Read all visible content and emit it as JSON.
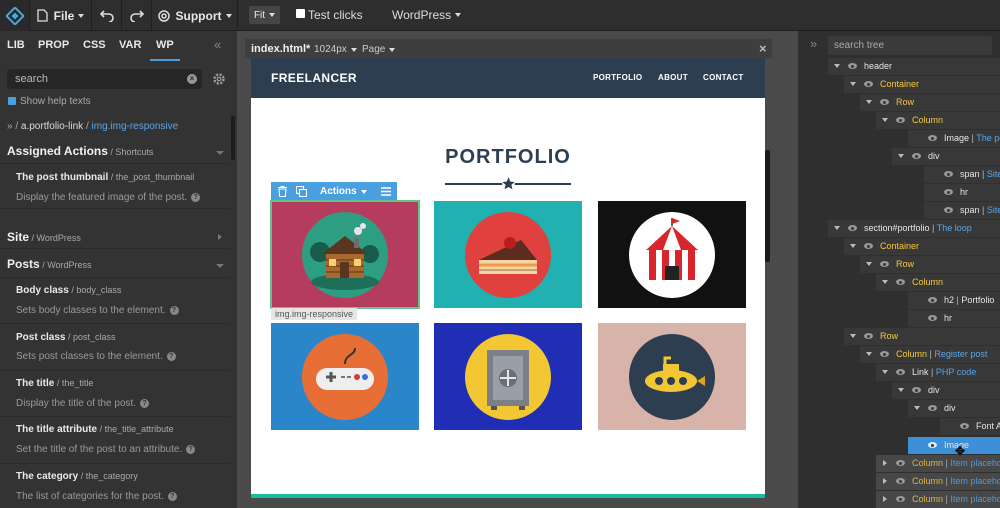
{
  "toolbar": {
    "file_label": "File",
    "support_label": "Support",
    "fit_label": "Fit",
    "test_clicks_label": "Test clicks",
    "wordpress_label": "WordPress"
  },
  "left_panel": {
    "tabs": [
      "LIB",
      "PROP",
      "CSS",
      "VAR",
      "WP"
    ],
    "active_tab": "WP",
    "search_placeholder": "search",
    "show_help_label": "Show help texts",
    "breadcrumb_prefix": "» / ",
    "breadcrumb_link": "a.portfolio-link",
    "breadcrumb_sep": " / ",
    "breadcrumb_current": "img.img-responsive",
    "assigned_actions_title": "Assigned Actions",
    "assigned_actions_sub": " / Shortcuts",
    "post_thumbnail_title": "The post thumbnail",
    "post_thumbnail_sub": " / the_post_thumbnail",
    "post_thumbnail_desc": "Display the featured image of the post.",
    "site_title": "Site",
    "site_sub": " / WordPress",
    "posts_title": "Posts",
    "posts_sub": " / WordPress",
    "items": [
      {
        "title": "Body class",
        "sub": " / body_class",
        "desc": "Sets body classes to the element."
      },
      {
        "title": "Post class",
        "sub": " / post_class",
        "desc": "Sets post classes to the element."
      },
      {
        "title": "The title",
        "sub": " / the_title",
        "desc": "Display the title of the post."
      },
      {
        "title": "The title attribute",
        "sub": " / the_title_attribute",
        "desc": "Set the title of the post to an attribute."
      },
      {
        "title": "The category",
        "sub": " / the_category",
        "desc": "The list of categories for the post."
      }
    ]
  },
  "canvas": {
    "file_name": "index.html*",
    "width_label": "1024px",
    "page_label": "Page",
    "brand": "FREELANCER",
    "nav": [
      "PORTFOLIO",
      "ABOUT",
      "CONTACT"
    ],
    "heading": "PORTFOLIO",
    "actions_label": "Actions",
    "selected_label": "img.img-responsive",
    "thumb_colors": [
      "#b63c5e",
      "#22b1b1",
      "#111111",
      "#2a86c8",
      "#1f2eb5",
      "#d7b3a9"
    ]
  },
  "right_panel": {
    "search_placeholder": "search tree",
    "rows": [
      {
        "text": "header",
        "cls": ""
      },
      {
        "text": "Container",
        "cls": "y"
      },
      {
        "text": "Row",
        "cls": "y"
      },
      {
        "text": "Column",
        "cls": "y"
      },
      {
        "text": "Image",
        "sep": " | ",
        "extra": "The post thumbnail"
      },
      {
        "text": "div",
        "cls": ""
      },
      {
        "text": "span",
        "sep": " | ",
        "extra": "Site name"
      },
      {
        "text": "hr",
        "cls": ""
      },
      {
        "text": "span",
        "sep": " | ",
        "extra": "Site description"
      },
      {
        "text": "section#portfolio",
        "sep": " | ",
        "extra": "The loop"
      },
      {
        "text": "Container",
        "cls": "y"
      },
      {
        "text": "Row",
        "cls": "y"
      },
      {
        "text": "Column",
        "cls": "y"
      },
      {
        "text": "h2",
        "sep": " | ",
        "extra": "Portfolio",
        "extra_cls": "plain"
      },
      {
        "text": "hr",
        "cls": ""
      },
      {
        "text": "Row",
        "cls": "y"
      },
      {
        "text": "Column",
        "cls": "y",
        "sep": " | ",
        "extra": "Register post"
      },
      {
        "text": "Link",
        "sep": " | ",
        "extra": "PHP code"
      },
      {
        "text": "div",
        "cls": ""
      },
      {
        "text": "div",
        "cls": ""
      },
      {
        "text": "Font Awesome",
        "cls": ""
      },
      {
        "text": "Image",
        "cls": ""
      },
      {
        "text": "Column",
        "cls": "y",
        "sep": " | ",
        "extra": "Item placeholder"
      },
      {
        "text": "Column",
        "cls": "y",
        "sep": " | ",
        "extra": "Item placeholder"
      },
      {
        "text": "Column",
        "cls": "y",
        "sep": " | ",
        "extra": "Item placeholder"
      }
    ]
  },
  "colors": {
    "accent_blue": "#4a9fde",
    "selected_row": "#3d8fd6",
    "nav_dark": "#2c3e50",
    "teal_bottom": "#18bc9c"
  }
}
